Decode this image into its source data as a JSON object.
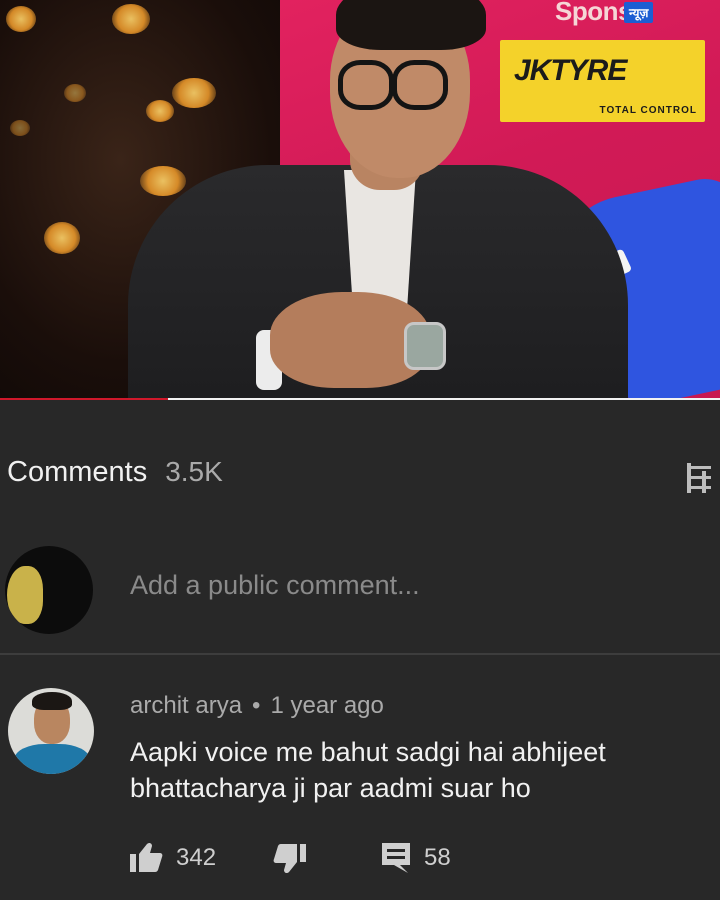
{
  "video": {
    "sponsor_text": "Sponso",
    "news_badge": "न्यूज़",
    "sponsor_logo": "JKTYRE",
    "sponsor_tagline": "TOTAL CONTROL"
  },
  "comments": {
    "title": "Comments",
    "count": "3.5K",
    "add_placeholder": "Add a public comment..."
  },
  "comment": {
    "author": "archit arya",
    "separator": "•",
    "time": "1 year ago",
    "text": "Aapki voice me bahut sadgi hai abhijeet bhattacharya ji par aadmi suar ho",
    "likes": "342",
    "replies": "58"
  },
  "colors": {
    "background": "#282828",
    "text_primary": "#f1f1f1",
    "text_secondary": "#aaaaaa"
  }
}
